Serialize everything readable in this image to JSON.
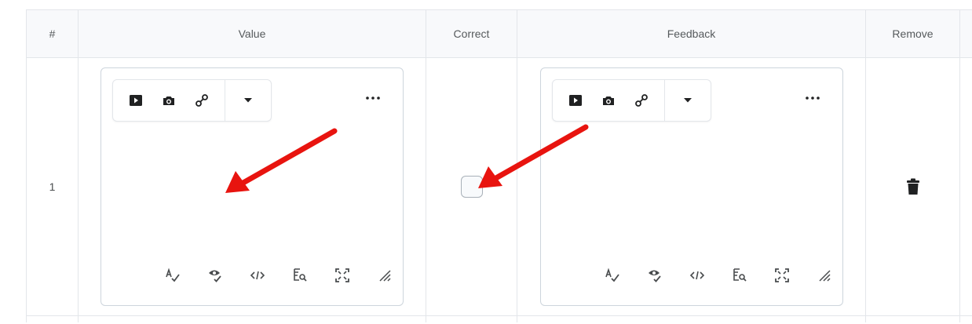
{
  "table": {
    "headers": {
      "number": "#",
      "value": "Value",
      "correct": "Correct",
      "feedback": "Feedback",
      "remove": "Remove"
    },
    "rows": [
      {
        "number": "1",
        "correct_checked": false
      }
    ]
  },
  "editor_toolbar": {
    "top_icons": [
      "insert-media-icon",
      "insert-image-icon",
      "insert-link-icon",
      "dropdown-chevron-icon"
    ],
    "more_icon": "more-options-icon",
    "bottom_icons": [
      "spellcheck-icon",
      "accessibility-checker-icon",
      "source-code-icon",
      "preview-icon",
      "fullscreen-icon",
      "resize-handle-icon"
    ]
  },
  "annotations": {
    "arrow_color": "#e8140f"
  },
  "colors": {
    "border": "#e3e6ea",
    "header_bg": "#f8f9fb",
    "text": "#494c4e"
  }
}
